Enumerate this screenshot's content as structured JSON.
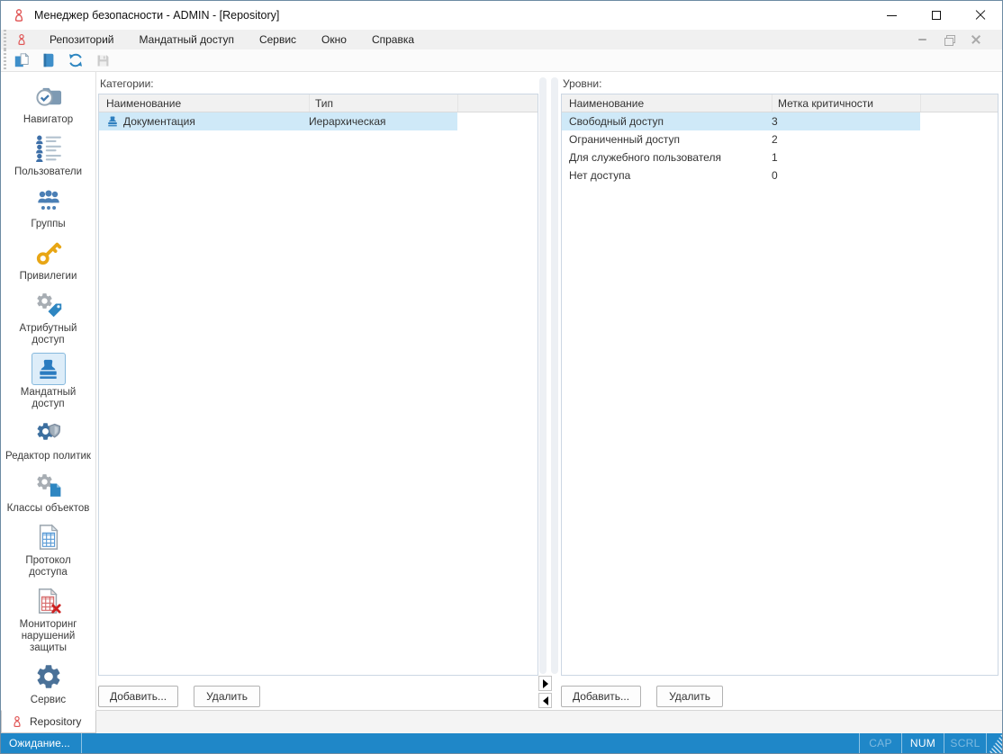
{
  "window": {
    "title": "Менеджер безопасности - ADMIN - [Repository]",
    "control_icons": [
      "minimize-icon",
      "maximize-icon",
      "close-icon"
    ],
    "app_icon": "red-person-icon"
  },
  "menu_bar": {
    "items": [
      "Репозиторий",
      "Мандатный доступ",
      "Сервис",
      "Окно",
      "Справка"
    ],
    "mdi_control_icons": [
      "mdi-minimize-icon",
      "mdi-restore-icon",
      "mdi-close-icon"
    ]
  },
  "toolbar": {
    "button_icons": [
      "new-document-icon",
      "open-repository-icon",
      "refresh-icon",
      "save-icon"
    ],
    "save_disabled": true
  },
  "sidebar": {
    "items": [
      {
        "label": "Навигатор",
        "icon": "navigator-icon",
        "selected": false
      },
      {
        "label": "Пользователи",
        "icon": "users-list-icon",
        "selected": false
      },
      {
        "label": "Группы",
        "icon": "groups-icon",
        "selected": false
      },
      {
        "label": "Привилегии",
        "icon": "key-icon",
        "selected": false
      },
      {
        "label": "Атрибутный доступ",
        "icon": "gear-tag-icon",
        "selected": false
      },
      {
        "label": "Мандатный доступ",
        "icon": "stamp-icon",
        "selected": true
      },
      {
        "label": "Редактор политик",
        "icon": "gear-shield-icon",
        "selected": false
      },
      {
        "label": "Классы объектов",
        "icon": "gear-page-icon",
        "selected": false
      },
      {
        "label": "Протокол доступа",
        "icon": "table-document-icon",
        "selected": false
      },
      {
        "label": "Мониторинг нарушений защиты",
        "icon": "table-document-error-icon",
        "selected": false
      },
      {
        "label": "Сервис",
        "icon": "gear-icon",
        "selected": false
      }
    ]
  },
  "panels": {
    "categories": {
      "title": "Категории:",
      "columns": [
        "Наименование",
        "Тип"
      ],
      "rows": [
        {
          "icon": "stamp-icon",
          "name": "Документация",
          "type": "Иерархическая",
          "selected": true
        }
      ],
      "add_button": "Добавить...",
      "delete_button": "Удалить"
    },
    "levels": {
      "title": "Уровни:",
      "columns": [
        "Наименование",
        "Метка критичности"
      ],
      "rows": [
        {
          "name": "Свободный доступ",
          "criticality": "3",
          "selected": true
        },
        {
          "name": "Ограниченный доступ",
          "criticality": "2",
          "selected": false
        },
        {
          "name": "Для служебного пользователя",
          "criticality": "1",
          "selected": false
        },
        {
          "name": "Нет доступа",
          "criticality": "0",
          "selected": false
        }
      ],
      "add_button": "Добавить...",
      "delete_button": "Удалить"
    }
  },
  "tab_bar": {
    "tabs": [
      {
        "label": "Repository",
        "icon": "red-person-icon",
        "active": true
      }
    ]
  },
  "status_bar": {
    "message": "Ожидание...",
    "indicators": [
      {
        "label": "CAP",
        "active": false
      },
      {
        "label": "NUM",
        "active": true
      },
      {
        "label": "SCRL",
        "active": false
      }
    ]
  },
  "colors": {
    "status_bar_blue": "#1f87c8",
    "row_selection": "#cfe9f8",
    "sidebar_selected_bg": "#ddedf9",
    "sidebar_selected_border": "#86b9dd",
    "icon_blue": "#2e86c1",
    "icon_steel_blue": "#4a7198",
    "icon_gray": "#a7adb3",
    "icon_red": "#e05252",
    "icon_gold": "#e8a615"
  }
}
